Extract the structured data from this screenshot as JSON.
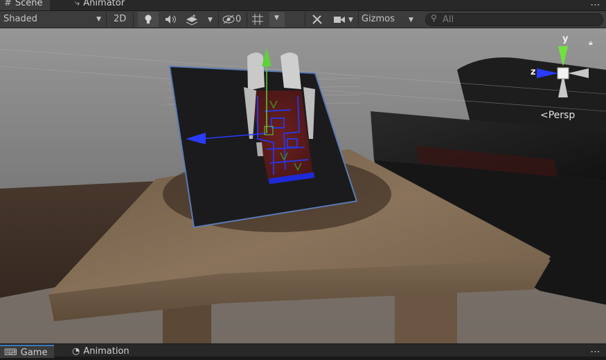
{
  "tabs": [
    {
      "label": "Scene",
      "icon": "hash-icon"
    },
    {
      "label": "Animator",
      "icon": "animator-icon"
    }
  ],
  "toolbar": {
    "draw_mode": "Shaded",
    "mode_2d": "2D",
    "hidden_count": "0",
    "gizmos_label": "Gizmos",
    "search_placeholder": "All"
  },
  "gizmo": {
    "y_label": "y",
    "z_label": "z",
    "projection": "Persp"
  },
  "bottom_tabs": [
    {
      "label": "Game",
      "icon": "gamepad-icon"
    },
    {
      "label": "Animation",
      "icon": "clock-icon"
    }
  ]
}
